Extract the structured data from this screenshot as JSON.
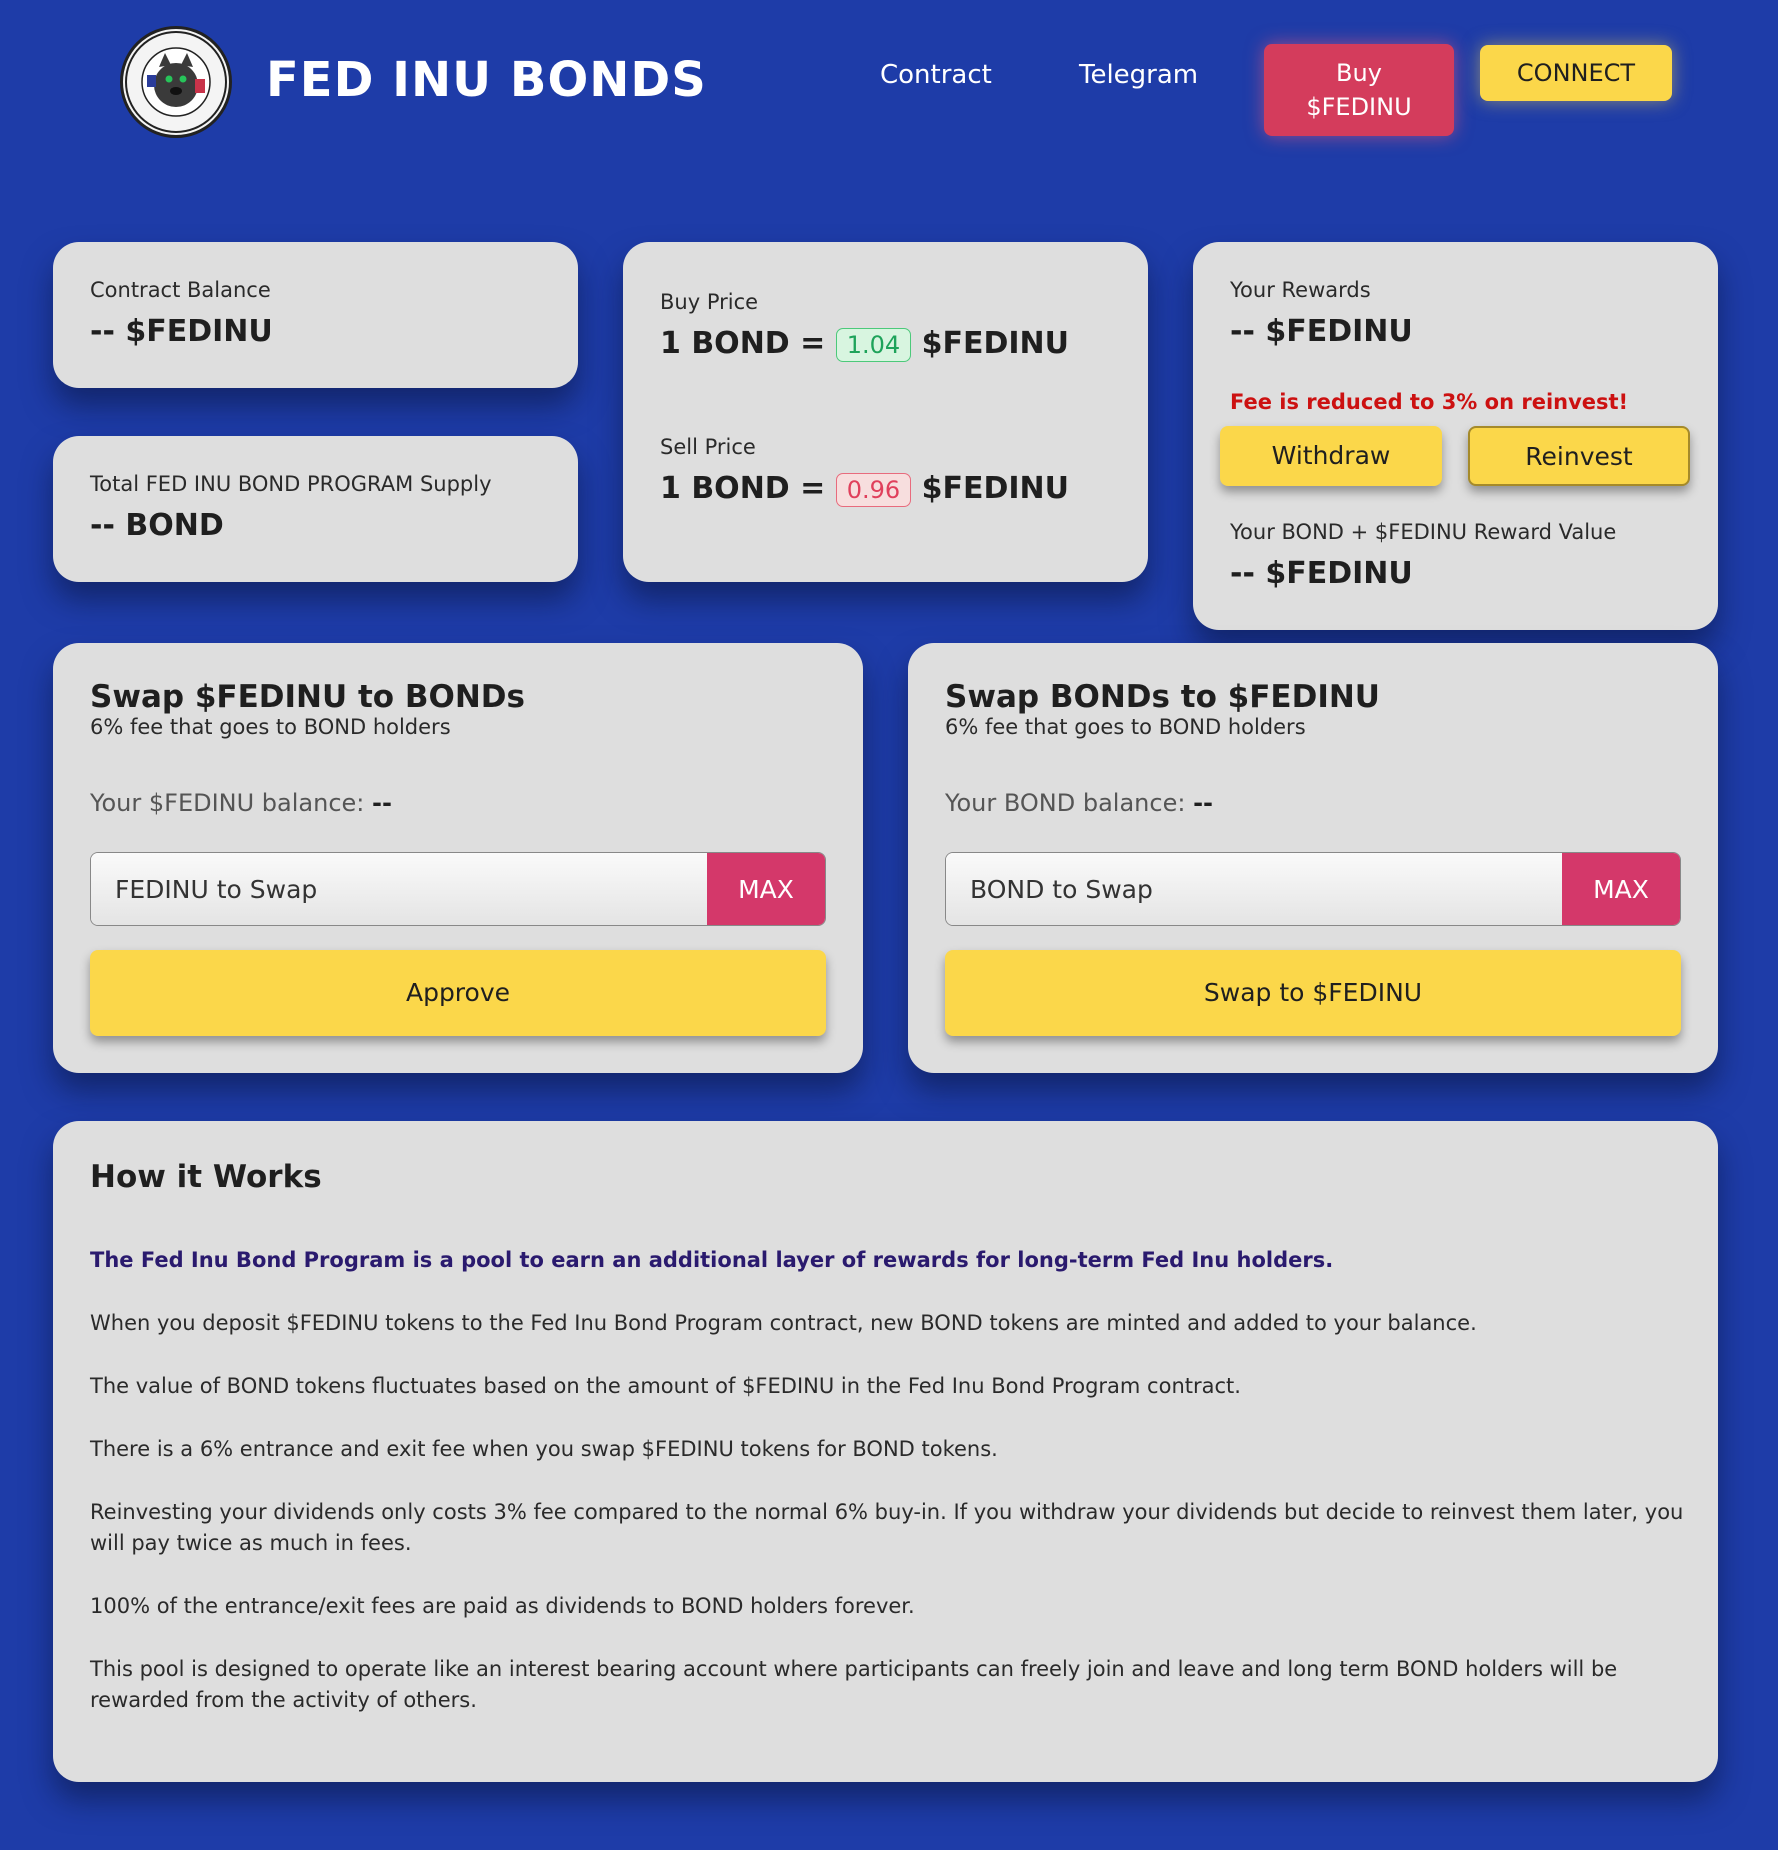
{
  "header": {
    "brand": "FED INU BONDS",
    "nav": [
      "Contract",
      "Telegram"
    ],
    "buy_line1": "Buy",
    "buy_line2": "$FEDINU",
    "connect": "CONNECT",
    "logo_text": "UNITED STATES FEDERAL RESERVE SYSTEM"
  },
  "contract_balance": {
    "label": "Contract Balance",
    "value": "-- $FEDINU"
  },
  "supply": {
    "label": "Total FED INU BOND PROGRAM Supply",
    "value": "-- BOND"
  },
  "prices": {
    "buy_label": "Buy Price",
    "buy_prefix": "1 BOND =",
    "buy_value": "1.04",
    "buy_suffix": "$FEDINU",
    "sell_label": "Sell Price",
    "sell_prefix": "1 BOND =",
    "sell_value": "0.96",
    "sell_suffix": "$FEDINU"
  },
  "rewards": {
    "label": "Your Rewards",
    "value": "-- $FEDINU",
    "fee_note": "Fee is reduced to 3% on reinvest!",
    "withdraw": "Withdraw",
    "reinvest": "Reinvest",
    "value_label": "Your BOND + $FEDINU Reward Value",
    "reward_value": "-- $FEDINU"
  },
  "swap_to_bond": {
    "title": "Swap $FEDINU to BONDs",
    "subtitle": "6% fee that goes to BOND holders",
    "balance_label": "Your $FEDINU balance:",
    "balance_value": "--",
    "placeholder": "FEDINU to Swap",
    "max": "MAX",
    "action": "Approve"
  },
  "swap_to_fedinu": {
    "title": "Swap BONDs to $FEDINU",
    "subtitle": "6% fee that goes to BOND holders",
    "balance_label": "Your BOND balance:",
    "balance_value": "--",
    "placeholder": "BOND to Swap",
    "max": "MAX",
    "action": "Swap to $FEDINU"
  },
  "how": {
    "title": "How it Works",
    "paragraphs": [
      "The Fed Inu Bond Program is a pool to earn an additional layer of rewards for long-term Fed Inu holders.",
      "When you deposit $FEDINU tokens to the Fed Inu Bond Program contract, new BOND tokens are minted and added to your balance.",
      "The value of BOND tokens fluctuates based on the amount of $FEDINU in the Fed Inu Bond Program contract.",
      "There is a 6% entrance and exit fee when you swap $FEDINU tokens for BOND tokens.",
      "Reinvesting your dividends only costs 3% fee compared to the normal 6% buy-in. If you withdraw your dividends but decide to reinvest them later, you will pay twice as much in fees.",
      "100% of the entrance/exit fees are paid as dividends to BOND holders forever.",
      "This pool is designed to operate like an interest bearing account where participants can freely join and leave and long term BOND holders will be rewarded from the activity of others."
    ]
  },
  "colors": {
    "background": "#1e3ca8",
    "card": "#dedede",
    "yellow": "#fbd74a",
    "pink": "#d4386a",
    "green": "#1ea35a",
    "red": "#cc1111"
  }
}
